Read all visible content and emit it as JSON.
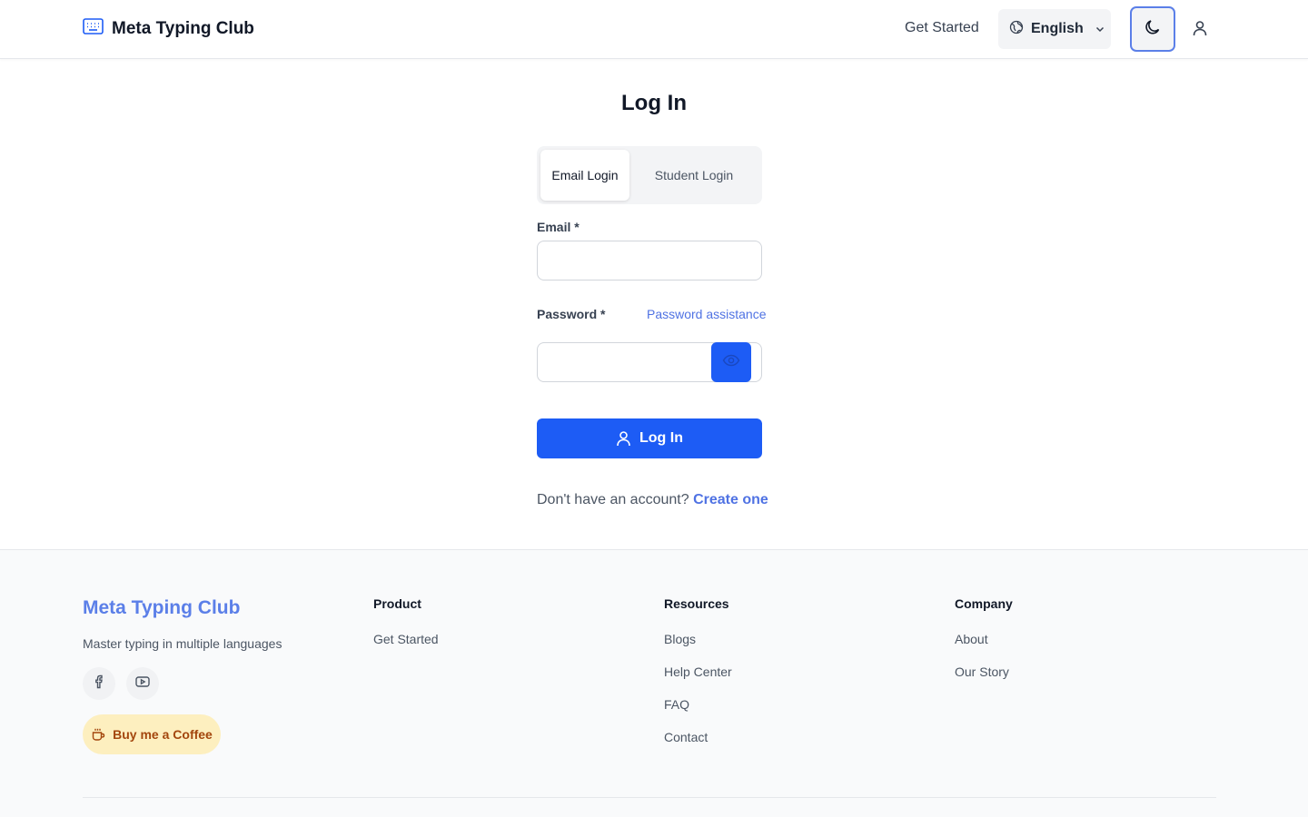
{
  "header": {
    "brand": "Meta Typing Club",
    "nav_get_started": "Get Started",
    "language": "English"
  },
  "login": {
    "title": "Log In",
    "tabs": [
      {
        "label": "Email Login",
        "active": true
      },
      {
        "label": "Student Login",
        "active": false
      }
    ],
    "email_label": "Email *",
    "email_value": "",
    "password_label": "Password *",
    "password_value": "",
    "password_assistance": "Password assistance",
    "submit_label": "Log In",
    "no_account_text": "Don't have an account?",
    "create_link": "Create one"
  },
  "footer": {
    "brand": "Meta Typing Club",
    "tagline": "Master typing in multiple languages",
    "coffee_label": "Buy me a Coffee",
    "columns": [
      {
        "title": "Product",
        "links": [
          "Get Started"
        ]
      },
      {
        "title": "Resources",
        "links": [
          "Blogs",
          "Help Center",
          "FAQ",
          "Contact"
        ]
      },
      {
        "title": "Company",
        "links": [
          "About",
          "Our Story"
        ]
      }
    ]
  },
  "colors": {
    "primary": "#1d5cf5",
    "link": "#4f72e3",
    "coffee_bg": "#fdefbf",
    "coffee_text": "#a3460d"
  },
  "icons": [
    "keyboard-icon",
    "globe-icon",
    "chevron-down-icon",
    "moon-icon",
    "user-icon",
    "eye-icon",
    "facebook-icon",
    "youtube-icon",
    "coffee-icon"
  ]
}
